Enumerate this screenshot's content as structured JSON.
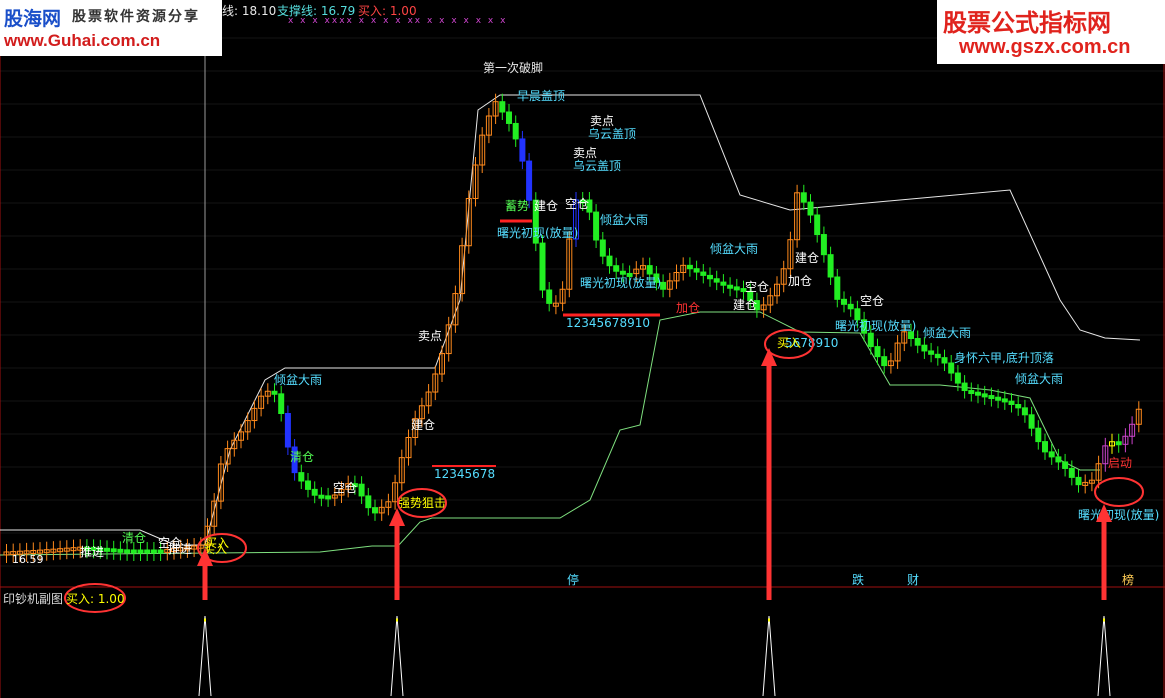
{
  "header": {
    "res_label_fragment": "线: 18.10",
    "support_label": "支撑线: 16.79",
    "buy_label": "买入: 1.00"
  },
  "watermark_left": {
    "brand": "股海网",
    "slogan": "股票软件资源分享",
    "url": "www.Guhai.com.cn"
  },
  "watermark_right": {
    "brand": "股票公式指标网",
    "url": "www.gszx.com.cn"
  },
  "subchart": {
    "title": "印钞机副图",
    "buy_value": "买入: 1.00"
  },
  "colors": {
    "background": "#000000",
    "candle_up": "#ff8a1c",
    "candle_down": "#22ee22",
    "candle_blue": "#2233ff",
    "candle_violet": "#cc44cc",
    "candle_yellow": "#ffff00",
    "resistance_line": "#e8e8e8",
    "support_line": "#7fe07f",
    "arrow": "#ff3333",
    "ellipse": "#ff3333",
    "divider": "#a01010",
    "signal_spike": "#ffffff"
  },
  "chart_data": {
    "type": "candlestick",
    "main_panel": {
      "low_marker": "16.59",
      "top_markers": "x x x xxxx x x x x xx x x x x x x x",
      "annotations": [
        {
          "text": "第一次破脚",
          "color": "#e8e8e8"
        },
        {
          "text": "早晨盖顶",
          "color": "#55ddff"
        },
        {
          "text": "卖点",
          "color": "#ffffff"
        },
        {
          "text": "乌云盖顶",
          "color": "#55ddff"
        },
        {
          "text": "卖点",
          "color": "#ffffff"
        },
        {
          "text": "乌云盖顶",
          "color": "#55ddff"
        },
        {
          "text": "倾盆大雨",
          "color": "#55ddff"
        },
        {
          "text": "倾盆大雨",
          "color": "#55ddff"
        },
        {
          "text": "倾盆大雨",
          "color": "#55ddff"
        },
        {
          "text": "倾盆大雨",
          "color": "#55ddff"
        },
        {
          "text": "倾盆大雨",
          "color": "#55ddff"
        },
        {
          "text": "曙光初现(放量)",
          "color": "#55ddff"
        },
        {
          "text": "曙光初现(放量)",
          "color": "#55ddff"
        },
        {
          "text": "曙光初现(放量)",
          "color": "#55ddff"
        },
        {
          "text": "曙光初现(放量)",
          "color": "#55ddff"
        },
        {
          "text": "12345678910",
          "color": "#55ddff"
        },
        {
          "text": "12345678",
          "color": "#55ddff"
        },
        {
          "text": "5678910",
          "color": "#55ddff"
        },
        {
          "text": "卖点",
          "color": "#ffffff"
        },
        {
          "text": "建仓",
          "color": "#ffffff"
        },
        {
          "text": "建仓",
          "color": "#ffffff"
        },
        {
          "text": "建仓",
          "color": "#ffffff"
        },
        {
          "text": "建仓",
          "color": "#ffffff"
        },
        {
          "text": "加仓",
          "color": "#ffffff"
        },
        {
          "text": "加仓",
          "color": "#ff3333"
        },
        {
          "text": "空仓",
          "color": "#ffffff"
        },
        {
          "text": "空仓",
          "color": "#ffffff"
        },
        {
          "text": "空仓",
          "color": "#ffffff"
        },
        {
          "text": "空仓",
          "color": "#ffffff"
        },
        {
          "text": "空仓",
          "color": "#ffffff"
        },
        {
          "text": "清仓",
          "color": "#55ff55"
        },
        {
          "text": "清仓",
          "color": "#55ff55"
        },
        {
          "text": "推进",
          "color": "#ffffff"
        },
        {
          "text": "推进",
          "color": "#ffffff"
        },
        {
          "text": "买入",
          "color": "#ffff00"
        },
        {
          "text": "买入",
          "color": "#ffff00"
        },
        {
          "text": "买入",
          "color": "#ffff00"
        },
        {
          "text": "强势狙击",
          "color": "#ffff00"
        },
        {
          "text": "身怀六甲,底升顶落",
          "color": "#55ddff"
        },
        {
          "text": "启动",
          "color": "#ff3333"
        },
        {
          "text": "蓄势",
          "color": "#55ff55"
        }
      ],
      "bottom_tags": [
        {
          "text": "停",
          "color": "#55ddff"
        },
        {
          "text": "跌",
          "color": "#55ddff"
        },
        {
          "text": "财",
          "color": "#55ddff"
        },
        {
          "text": "榜",
          "color": "#ffcc55"
        }
      ]
    },
    "sub_panel": {
      "series": [
        {
          "name": "买入",
          "signals": [
            1,
            1,
            1,
            1
          ]
        }
      ]
    }
  }
}
